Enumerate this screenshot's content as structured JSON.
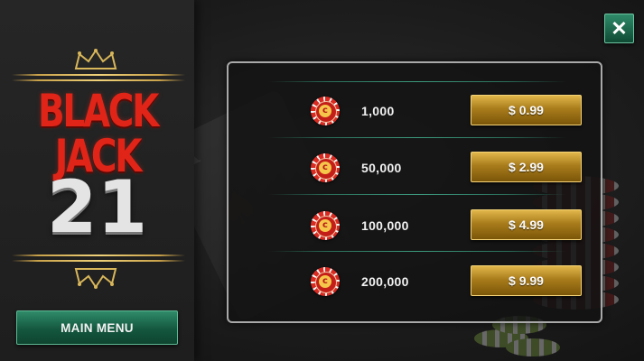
{
  "logo": {
    "title": "BLACK JACK",
    "number": "21"
  },
  "left_panel": {
    "main_menu_label": "MAIN MENU"
  },
  "close_button": {
    "glyph": "✕"
  },
  "store": {
    "items": [
      {
        "amount": "1,000",
        "price": "$ 0.99",
        "icon": "chip-icon"
      },
      {
        "amount": "50,000",
        "price": "$ 2.99",
        "icon": "chip-icon"
      },
      {
        "amount": "100,000",
        "price": "$ 4.99",
        "icon": "chip-icon"
      },
      {
        "amount": "200,000",
        "price": "$ 9.99",
        "icon": "chip-icon"
      }
    ]
  },
  "colors": {
    "accent_green": "#14573f",
    "gold": "#c9a24a",
    "logo_red": "#e02418"
  }
}
